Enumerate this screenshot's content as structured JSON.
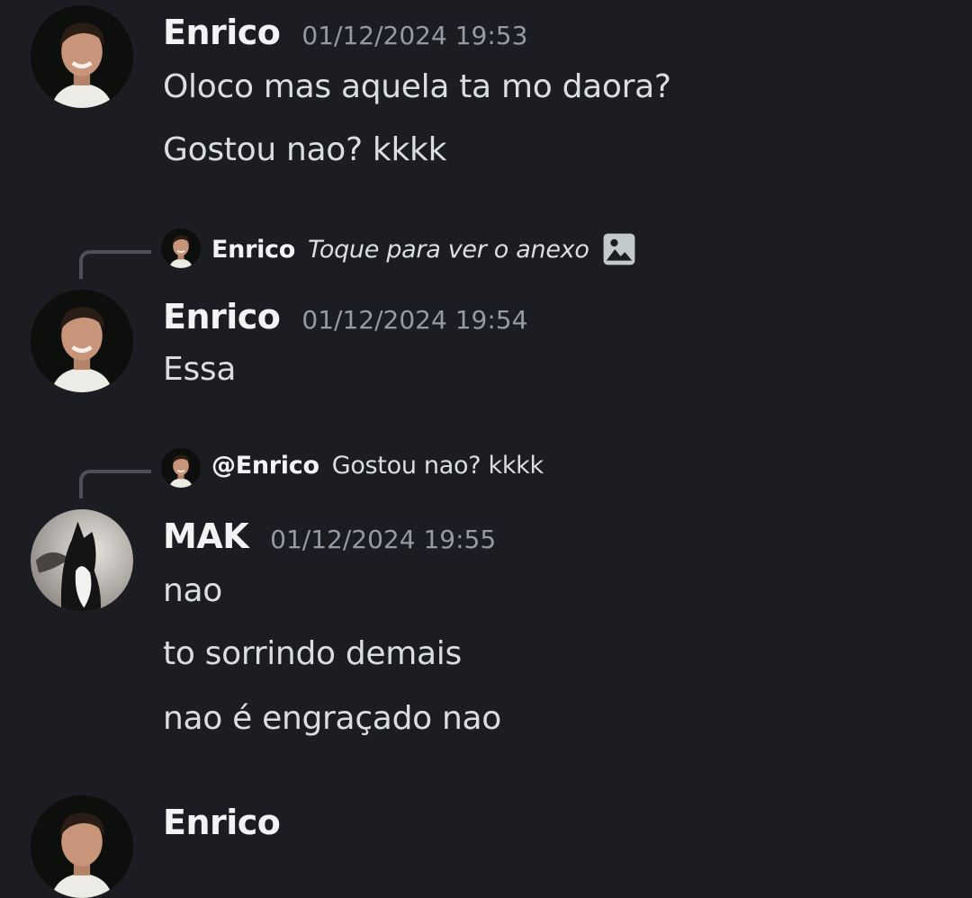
{
  "messages": [
    {
      "author": "Enrico",
      "timestamp": "01/12/2024 19:53",
      "avatar_icon": "user-avatar-photo",
      "lines": [
        "Oloco mas aquela ta mo daora?",
        "Gostou nao? kkkk"
      ]
    },
    {
      "reply": {
        "author": "Enrico",
        "content": "Toque para ver o anexo",
        "attachment_icon": "image-icon"
      },
      "author": "Enrico",
      "timestamp": "01/12/2024 19:54",
      "avatar_icon": "user-avatar-photo",
      "lines": [
        "Essa"
      ]
    },
    {
      "reply": {
        "author": "@Enrico",
        "content": "Gostou nao? kkkk"
      },
      "author": "MAK",
      "timestamp": "01/12/2024 19:55",
      "avatar_icon": "cat-avatar-photo",
      "lines": [
        "nao",
        "to sorrindo demais",
        "nao é engraçado nao"
      ]
    },
    {
      "author": "Enrico",
      "avatar_icon": "user-avatar-photo"
    }
  ],
  "colors": {
    "background": "#1c1d22",
    "username": "#f2f3f5",
    "timestamp": "#949ba4",
    "message_text": "#dbdee1",
    "reply_spine": "#4e5058"
  }
}
